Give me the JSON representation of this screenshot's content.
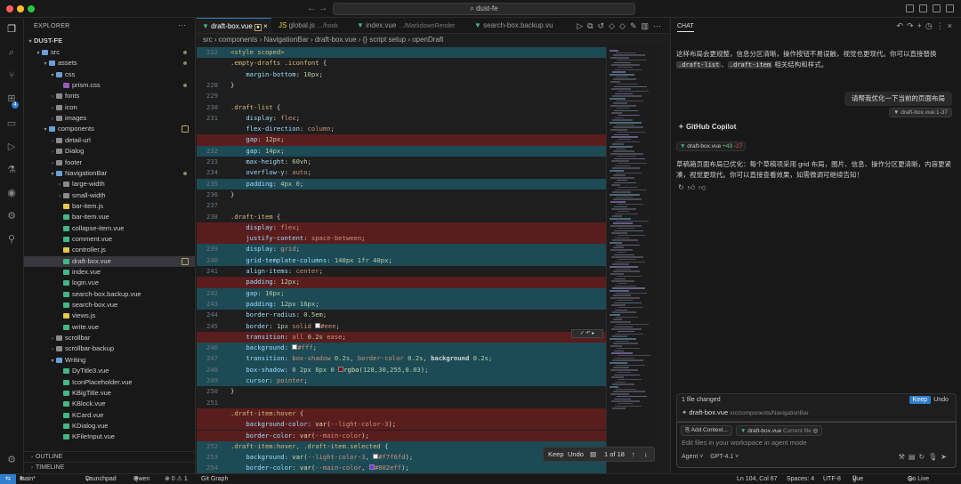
{
  "window": {
    "title": "dust-fe"
  },
  "explorer": {
    "title": "EXPLORER",
    "root": "DUST-FE",
    "items": [
      {
        "label": "src",
        "depth": 1,
        "type": "folder-open"
      },
      {
        "label": "assets",
        "depth": 2,
        "type": "folder-open"
      },
      {
        "label": "css",
        "depth": 3,
        "type": "folder-open"
      },
      {
        "label": "prism.css",
        "depth": 4,
        "type": "css"
      },
      {
        "label": "fonts",
        "depth": 3,
        "type": "folder"
      },
      {
        "label": "icon",
        "depth": 3,
        "type": "folder"
      },
      {
        "label": "images",
        "depth": 3,
        "type": "folder"
      },
      {
        "label": "components",
        "depth": 2,
        "type": "folder-open"
      },
      {
        "label": "detail-url",
        "depth": 3,
        "type": "folder"
      },
      {
        "label": "Dialog",
        "depth": 3,
        "type": "folder"
      },
      {
        "label": "footer",
        "depth": 3,
        "type": "folder"
      },
      {
        "label": "NavigationBar",
        "depth": 3,
        "type": "folder-open"
      },
      {
        "label": "large-width",
        "depth": 4,
        "type": "folder"
      },
      {
        "label": "small-width",
        "depth": 4,
        "type": "folder"
      },
      {
        "label": "bar-item.js",
        "depth": 4,
        "type": "js"
      },
      {
        "label": "bar-item.vue",
        "depth": 4,
        "type": "vue"
      },
      {
        "label": "collapse-item.vue",
        "depth": 4,
        "type": "vue"
      },
      {
        "label": "comment.vue",
        "depth": 4,
        "type": "vue"
      },
      {
        "label": "controller.js",
        "depth": 4,
        "type": "js"
      },
      {
        "label": "draft-box.vue",
        "depth": 4,
        "type": "vue",
        "active": true
      },
      {
        "label": "index.vue",
        "depth": 4,
        "type": "vue"
      },
      {
        "label": "login.vue",
        "depth": 4,
        "type": "vue"
      },
      {
        "label": "search-box.backup.vue",
        "depth": 4,
        "type": "vue"
      },
      {
        "label": "search-box.vue",
        "depth": 4,
        "type": "vue"
      },
      {
        "label": "views.js",
        "depth": 4,
        "type": "js"
      },
      {
        "label": "write.vue",
        "depth": 4,
        "type": "vue"
      },
      {
        "label": "scrollbar",
        "depth": 3,
        "type": "folder"
      },
      {
        "label": "scrollbar-backup",
        "depth": 3,
        "type": "folder"
      },
      {
        "label": "Writing",
        "depth": 3,
        "type": "folder-open"
      },
      {
        "label": "DyTitle3.vue",
        "depth": 4,
        "type": "vue"
      },
      {
        "label": "IconPlaceholder.vue",
        "depth": 4,
        "type": "vue"
      },
      {
        "label": "KBigTitle.vue",
        "depth": 4,
        "type": "vue"
      },
      {
        "label": "KBlock.vue",
        "depth": 4,
        "type": "vue"
      },
      {
        "label": "KCard.vue",
        "depth": 4,
        "type": "vue"
      },
      {
        "label": "KDialog.vue",
        "depth": 4,
        "type": "vue"
      },
      {
        "label": "KFileInput.vue",
        "depth": 4,
        "type": "vue"
      }
    ],
    "outline": "OUTLINE",
    "timeline": "TIMELINE"
  },
  "tabs": [
    {
      "label": "draft-box.vue",
      "sub": "",
      "active": true
    },
    {
      "label": "global.js",
      "sub": ".../hook"
    },
    {
      "label": "index.vue",
      "sub": ".../MarkdownRender"
    },
    {
      "label": "search-box.backup.vu",
      "sub": ""
    }
  ],
  "breadcrumb": "src › components › NavigationBar › draft-box.vue › {} script setup › openDraft",
  "code": [
    {
      "n": "222",
      "t": "add",
      "h": "<span class='k'>&lt;style scoped&gt;</span>"
    },
    {
      "n": "",
      "t": "",
      "h": "<span class='k'>.empty-drafts .iconfont</span> {"
    },
    {
      "n": "",
      "t": "",
      "h": "    <span class='p'>margin-bottom</span>: <span class='n'>10px</span>;"
    },
    {
      "n": "228",
      "t": "",
      "h": "}"
    },
    {
      "n": "229",
      "t": "",
      "h": ""
    },
    {
      "n": "230",
      "t": "",
      "h": "<span class='k'>.draft-list</span> {"
    },
    {
      "n": "231",
      "t": "",
      "h": "    <span class='p'>display</span>: <span class='v'>flex</span>;"
    },
    {
      "n": "",
      "t": "",
      "h": "    <span class='p'>flex-direction</span>: <span class='v'>column</span>;"
    },
    {
      "n": "",
      "t": "del",
      "h": "    <span class='p'>gap</span>: <span class='n'>12px</span>;"
    },
    {
      "n": "232",
      "t": "add",
      "h": "    <span class='p'>gap</span>: <span class='n'>14px</span>;"
    },
    {
      "n": "233",
      "t": "",
      "h": "    <span class='p'>max-height</span>: <span class='n'>60vh</span>;"
    },
    {
      "n": "234",
      "t": "",
      "h": "    <span class='p'>overflow-y</span>: <span class='v'>auto</span>;"
    },
    {
      "n": "235",
      "t": "add",
      "h": "    <span class='p'>padding</span>: <span class='n'>4px 0</span>;"
    },
    {
      "n": "236",
      "t": "",
      "h": "}"
    },
    {
      "n": "237",
      "t": "",
      "h": ""
    },
    {
      "n": "238",
      "t": "",
      "h": "<span class='k'>.draft-item</span> {"
    },
    {
      "n": "",
      "t": "del",
      "h": "    <span class='p'>display</span>: <span class='v'>flex</span>;"
    },
    {
      "n": "",
      "t": "del",
      "h": "    <span class='p'>justify-content</span>: <span class='v'>space-between</span>;"
    },
    {
      "n": "239",
      "t": "add",
      "h": "    <span class='p'>display</span>: <span class='v'>grid</span>;"
    },
    {
      "n": "240",
      "t": "add",
      "h": "    <span class='p'>grid-template-columns</span>: <span class='n'>140px 1fr 40px</span>;"
    },
    {
      "n": "241",
      "t": "",
      "h": "    <span class='p'>align-items</span>: <span class='v'>center</span>;"
    },
    {
      "n": "",
      "t": "del",
      "h": "    <span class='p'>padding</span>: <span class='n'>12px</span>;"
    },
    {
      "n": "242",
      "t": "add",
      "h": "    <span class='p'>gap</span>: <span class='n'>16px</span>;"
    },
    {
      "n": "243",
      "t": "add",
      "h": "    <span class='p'>padding</span>: <span class='n'>12px 16px</span>;"
    },
    {
      "n": "244",
      "t": "",
      "h": "    <span class='p'>border-radius</span>: <span class='n'>0.5em</span>;"
    },
    {
      "n": "245",
      "t": "",
      "h": "    <span class='p'>border</span>: <span class='n'>1px</span> <span class='v'>solid</span> <span style='display:inline-block;width:6px;height:6px;background:#eee;border:1px solid #888'></span><span class='v'>#eee</span>;"
    },
    {
      "n": "",
      "t": "del",
      "h": "    <span class='p'>transition</span>: <span class='v'>all</span> <span class='n'>0.2s</span> <span class='v'>ease</span>;"
    },
    {
      "n": "246",
      "t": "add",
      "h": "    <span class='p'>background</span>: <span style='display:inline-block;width:6px;height:6px;background:#fff;border:1px solid #888'></span><span class='v'>#fff</span>;"
    },
    {
      "n": "247",
      "t": "add",
      "h": "    <span class='p'>transition</span>: <span class='v'>box-shadow</span> <span class='n'>0.2s</span>, <span class='v'>border-color</span> <span class='n'>0.2s</span>, <b>background</b> <span class='n'>0.2s</span>;"
    },
    {
      "n": "248",
      "t": "add",
      "h": "    <span class='p'>box-shadow</span>: <span class='n'>0 2px 8px 0</span> <span style='display:inline-block;width:6px;height:6px;background:#801e;border:1px solid #888'></span><span class='f'>rgba</span>(<span class='n'>128,30,255,0.03</span>);"
    },
    {
      "n": "249",
      "t": "add",
      "h": "    <span class='p'>cursor</span>: <span class='v'>pointer</span>;"
    },
    {
      "n": "250",
      "t": "",
      "h": "}"
    },
    {
      "n": "251",
      "t": "",
      "h": ""
    },
    {
      "n": "",
      "t": "del",
      "h": "<span class='k'>.draft-item:hover</span> {"
    },
    {
      "n": "",
      "t": "del",
      "h": "    <span class='p'>background-color</span>: <span class='f'>var</span>(<span class='v'>--light-color-3</span>);"
    },
    {
      "n": "",
      "t": "del",
      "h": "    <span class='p'>border-color</span>: <span class='f'>var</span>(<span class='v'>--main-color</span>);"
    },
    {
      "n": "252",
      "t": "add",
      "h": "<span class='k'>.draft-item:hover, .draft-item.selected</span> {"
    },
    {
      "n": "253",
      "t": "add",
      "h": "    <span class='p'>background</span>: <span class='f'>var</span>(<span class='v'>--light-color-3</span>, <span style='display:inline-block;width:6px;height:6px;background:#f7f6fd;border:1px solid #888'></span><span class='v'>#f7f6fd</span>);"
    },
    {
      "n": "254",
      "t": "add",
      "h": "    <span class='p'>border-color</span>: <span class='f'>var</span>(<span class='v'>--main-color</span>, <span style='display:inline-block;width:6px;height:6px;background:#802eff;border:1px solid #888'></span><span class='v'>#802eff</span>);"
    }
  ],
  "inline_actions": "✓ ↶ ▸",
  "diff_nav": {
    "keep": "Keep",
    "undo": "Undo",
    "count": "1 of 18"
  },
  "chat": {
    "tab": "CHAT",
    "ai_msg_1": "这样布局会更规整，信息分区清晰，操作按钮不易误触，视觉也更现代。你可以直接替换 ",
    "chip_1": ".draft-list",
    "sep": "、",
    "chip_2": ".draft-item",
    "ai_msg_1_end": " 相关结构和样式。",
    "user_msg": "请帮我优化一下当前的页面布局",
    "user_ref": "draft-box.vue:1-37",
    "copilot_name": "GitHub Copilot",
    "diff_file": "draft-box.vue",
    "diff_add": "+43",
    "diff_del": "-27",
    "ai_msg_2": "草稿箱页面布局已优化：每个草稿项采用 grid 布局，图片、信息、操作分区更清晰，内容更紧凑，视觉更现代。你可以直接查看效果，如需微调可继续告知！",
    "changed_label": "1 file changed",
    "keep": "Keep",
    "undo": "Undo",
    "changed_file": "draft-box.vue",
    "changed_path": "src/components/NavigationBar",
    "add_context": "Add Context...",
    "ctx_file": "draft-box.vue",
    "ctx_current": "Current file",
    "placeholder": "Edit files in your workspace in agent mode",
    "mode": "Agent ˅",
    "model": "GPT-4.1 ˅"
  },
  "status": {
    "branch": "main*",
    "launchpad": "Launchpad",
    "qwen": "Qwen",
    "problems": "⊗ 0 ⚠ 1",
    "git_graph": "Git Graph",
    "position": "Ln 104, Col 67",
    "spaces": "Spaces: 4",
    "encoding": "UTF-8",
    "lang": "Vue",
    "golive": "Go Live"
  }
}
